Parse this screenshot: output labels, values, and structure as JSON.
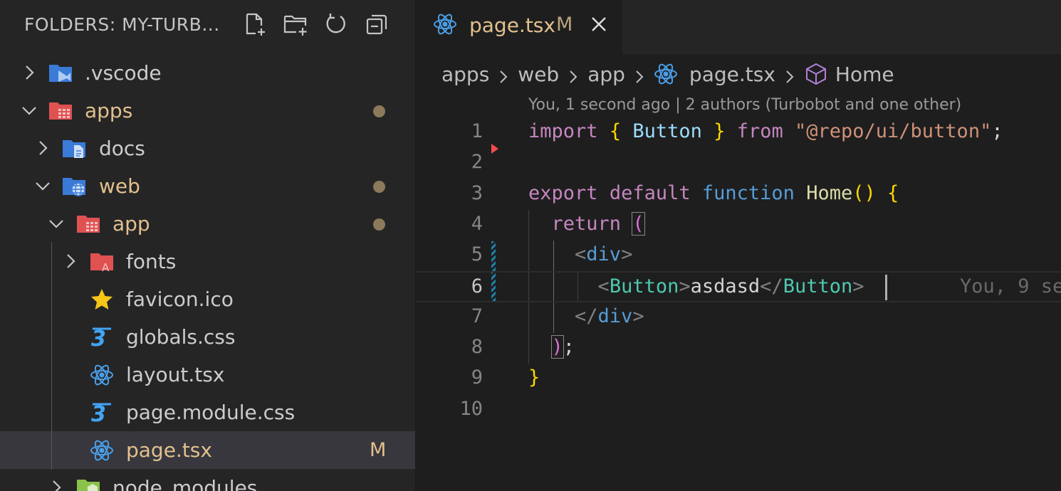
{
  "sidebar": {
    "title": "FOLDERS: MY-TURB...",
    "actions": [
      {
        "name": "new-file-icon"
      },
      {
        "name": "new-folder-icon"
      },
      {
        "name": "refresh-icon"
      },
      {
        "name": "collapse-all-icon"
      }
    ],
    "tree": [
      {
        "label": ".vscode",
        "indent": 0,
        "expanded": false,
        "kind": "folder-vscode",
        "modified": false,
        "dot": false,
        "badge": ""
      },
      {
        "label": "apps",
        "indent": 0,
        "expanded": true,
        "kind": "folder-app",
        "modified": true,
        "dot": true,
        "badge": ""
      },
      {
        "label": "docs",
        "indent": 1,
        "expanded": false,
        "kind": "folder-docs",
        "modified": false,
        "dot": false,
        "badge": ""
      },
      {
        "label": "web",
        "indent": 1,
        "expanded": true,
        "kind": "folder-web",
        "modified": true,
        "dot": true,
        "badge": ""
      },
      {
        "label": "app",
        "indent": 2,
        "expanded": true,
        "kind": "folder-app",
        "modified": true,
        "dot": true,
        "badge": ""
      },
      {
        "label": "fonts",
        "indent": 3,
        "expanded": false,
        "kind": "folder-fonts",
        "modified": false,
        "dot": false,
        "badge": ""
      },
      {
        "label": "favicon.ico",
        "indent": 3,
        "expanded": null,
        "kind": "file-favicon",
        "modified": false,
        "dot": false,
        "badge": ""
      },
      {
        "label": "globals.css",
        "indent": 3,
        "expanded": null,
        "kind": "file-css",
        "modified": false,
        "dot": false,
        "badge": ""
      },
      {
        "label": "layout.tsx",
        "indent": 3,
        "expanded": null,
        "kind": "file-react",
        "modified": false,
        "dot": false,
        "badge": ""
      },
      {
        "label": "page.module.css",
        "indent": 3,
        "expanded": null,
        "kind": "file-css",
        "modified": false,
        "dot": false,
        "badge": ""
      },
      {
        "label": "page.tsx",
        "indent": 3,
        "expanded": null,
        "kind": "file-react",
        "modified": true,
        "dot": false,
        "badge": "M",
        "selected": true
      },
      {
        "label": "node_modules",
        "indent": 1,
        "expanded": false,
        "kind": "folder-node",
        "modified": false,
        "dot": false,
        "badge": ""
      }
    ]
  },
  "editor": {
    "tab": {
      "label": "page.tsx",
      "badge": "M"
    },
    "breadcrumb": {
      "items": [
        "apps",
        "web",
        "app",
        "page.tsx",
        "Home"
      ]
    },
    "codelens": "You, 1 second ago | 2 authors (Turbobot and one other)",
    "ghost_blame": "You, 9 se",
    "line_numbers": [
      "1",
      "2",
      "3",
      "4",
      "5",
      "6",
      "7",
      "8",
      "9",
      "10"
    ],
    "active_line": "6",
    "code": {
      "l1": {
        "kw": "import",
        "b1": "{",
        "id": "Button",
        "b2": "}",
        "from": "from",
        "str": "\"@repo/ui/button\"",
        "end": ";"
      },
      "l3": {
        "k1": "export",
        "k2": "default",
        "k3": "function",
        "fn": "Home",
        "paren": "()",
        "brace": "{"
      },
      "l4": {
        "kw": "return",
        "paren": "("
      },
      "l5": {
        "lt": "<",
        "tag": "div",
        "gt": ">"
      },
      "l6": {
        "lt": "<",
        "tag": "Button",
        "gt": ">",
        "text": "asdasd",
        "lt2": "</",
        "tag2": "Button",
        "gt2": ">"
      },
      "l7": {
        "lt": "</",
        "tag": "div",
        "gt": ">"
      },
      "l8": {
        "paren": ")",
        "end": ";"
      },
      "l9": {
        "brace": "}"
      }
    }
  }
}
